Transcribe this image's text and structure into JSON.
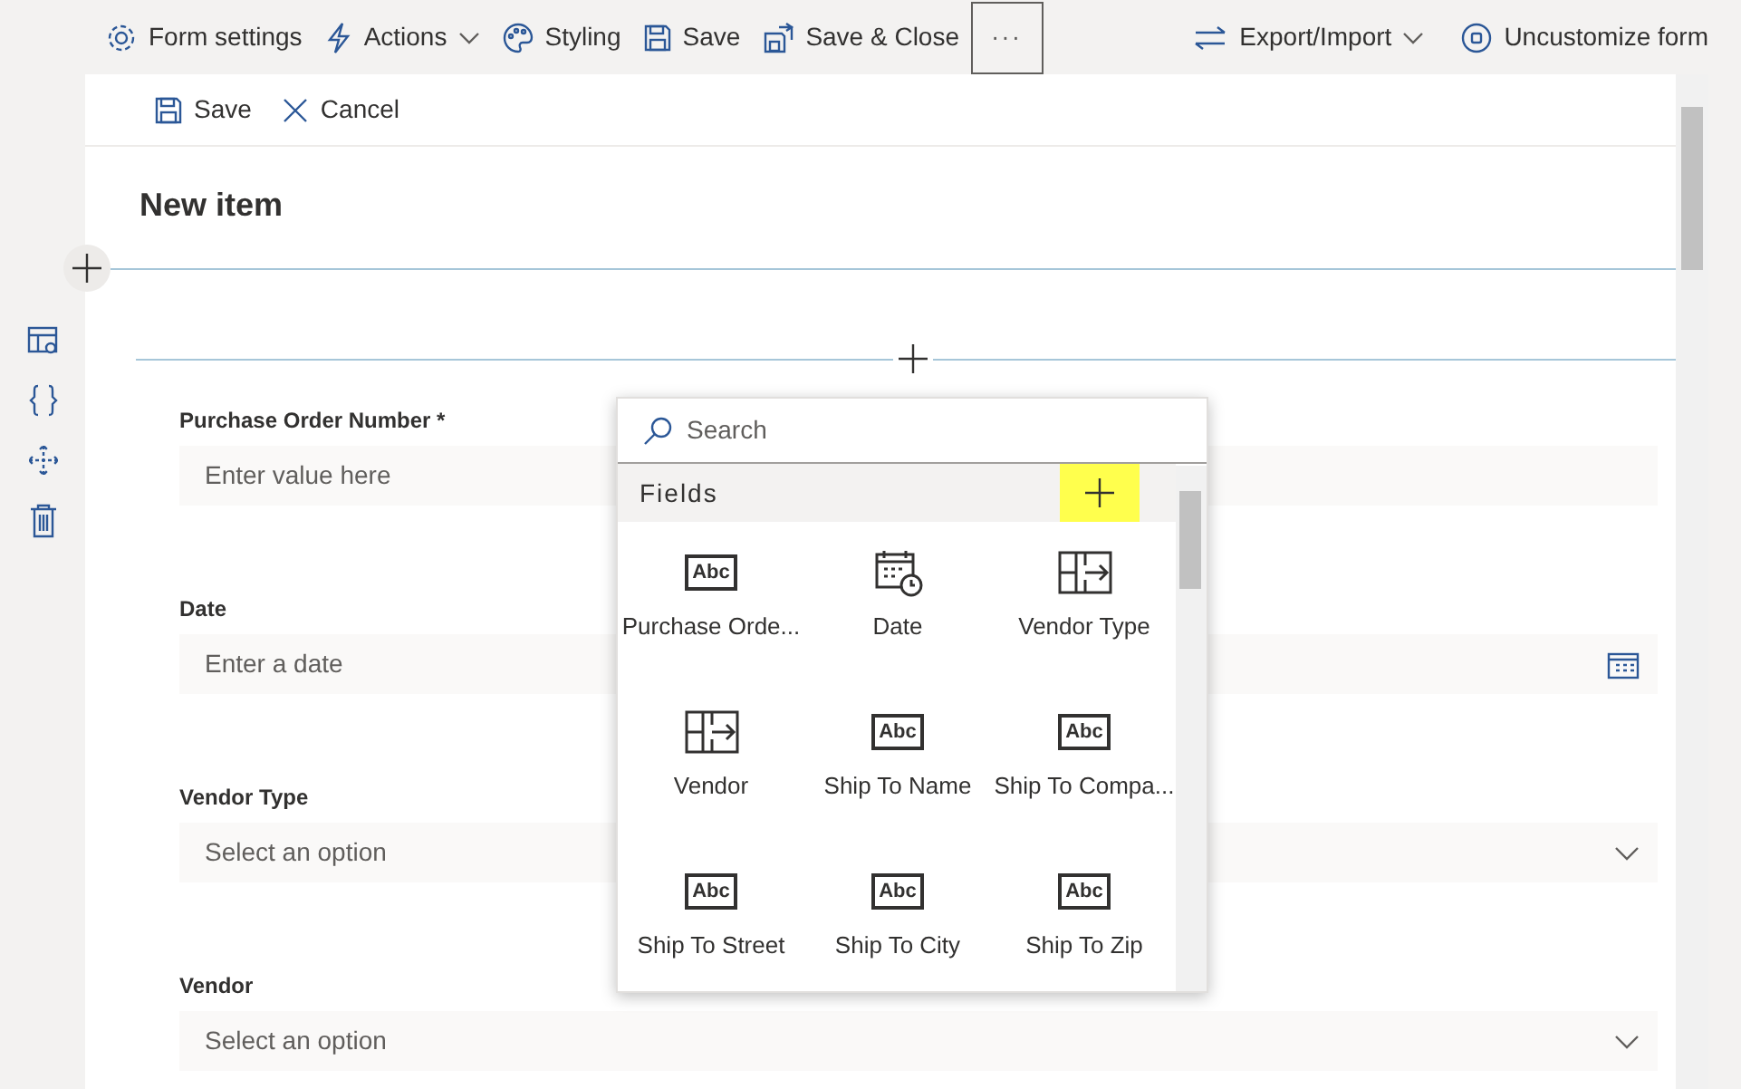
{
  "toolbar": {
    "left": [
      {
        "label": "Form settings",
        "dropdown": false
      },
      {
        "label": "Actions",
        "dropdown": true
      },
      {
        "label": "Styling",
        "dropdown": false
      },
      {
        "label": "Save",
        "dropdown": false
      },
      {
        "label": "Save & Close",
        "dropdown": false
      }
    ],
    "more": {
      "label": "···",
      "focused": true
    },
    "right": [
      {
        "label": "Export/Import",
        "dropdown": true
      },
      {
        "label": "Uncustomize form",
        "dropdown": false
      }
    ]
  },
  "command_bar": [
    {
      "label": "Save"
    },
    {
      "label": "Cancel"
    }
  ],
  "form": {
    "title": "New item",
    "fields": [
      {
        "label": "Purchase Order Number",
        "required_mark": "*",
        "kind": "text",
        "placeholder": "Enter value here"
      },
      {
        "label": "Date",
        "kind": "date",
        "placeholder": "Enter a date"
      },
      {
        "label": "Vendor Type",
        "kind": "choice",
        "placeholder": "Select an option"
      },
      {
        "label": "Vendor",
        "kind": "choice",
        "placeholder": "Select an option"
      }
    ]
  },
  "field_picker": {
    "search_placeholder": "Search",
    "header": "Fields",
    "add_highlighted": true,
    "items": [
      {
        "label": "Purchase Orde...",
        "kind": "text",
        "icon_text": "Abc"
      },
      {
        "label": "Date",
        "kind": "date"
      },
      {
        "label": "Vendor Type",
        "kind": "lookup"
      },
      {
        "label": "Vendor",
        "kind": "lookup"
      },
      {
        "label": "Ship To Name",
        "kind": "text",
        "icon_text": "Abc"
      },
      {
        "label": "Ship To Compa...",
        "kind": "text",
        "icon_text": "Abc"
      },
      {
        "label": "Ship To Street",
        "kind": "text",
        "icon_text": "Abc"
      },
      {
        "label": "Ship To City",
        "kind": "text",
        "icon_text": "Abc"
      },
      {
        "label": "Ship To Zip",
        "kind": "text",
        "icon_text": "Abc"
      }
    ]
  }
}
